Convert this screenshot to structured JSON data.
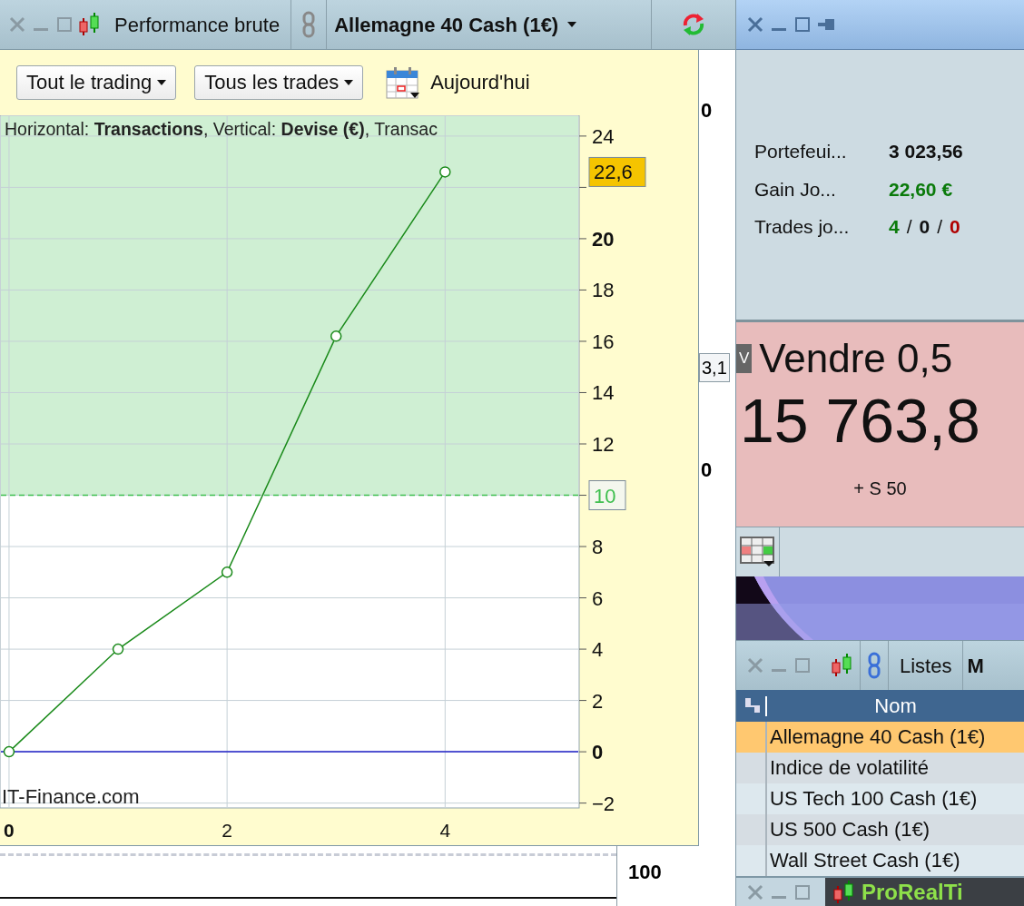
{
  "chart_window": {
    "title": "Performance brute",
    "instrument": "Allemagne 40 Cash (1€)",
    "filters": [
      {
        "label": "Tout le trading"
      },
      {
        "label": "Tous les trades"
      }
    ],
    "date_button": "Aujourd'hui",
    "chart_title": "Horizontal: **Transactions**, Vertical: **Devise (€)**, Transac",
    "credit": "IT-Finance.com",
    "chart_data": {
      "type": "line",
      "x": [
        0,
        1,
        2,
        3,
        4
      ],
      "series": [
        {
          "color": "#1a8a1a",
          "marker": "o",
          "values": [
            0,
            4,
            7,
            16.2,
            22.6
          ]
        }
      ],
      "xlim": [
        -0.083,
        5.23
      ],
      "ylim": [
        -2.19,
        24.81
      ],
      "xticks": [
        0,
        2,
        4
      ],
      "yticks": [
        -2,
        0,
        2,
        4,
        6,
        8,
        10,
        12,
        14,
        16,
        18,
        20,
        24
      ],
      "grid": true,
      "ref_lines": [
        {
          "axis": "y",
          "value": 0,
          "color": "#2020c8"
        },
        {
          "axis": "y",
          "value": 10,
          "color": "#3fbf4f",
          "label": "10"
        }
      ],
      "annotations": [
        "22,6"
      ]
    }
  },
  "background_chart": {
    "labels": [
      {
        "text": "0",
        "kind": "tick"
      },
      {
        "text": "3,1",
        "kind": "price"
      },
      {
        "text": "0",
        "kind": "tick"
      }
    ],
    "axis_label": "100"
  },
  "portfolio_panel": {
    "rows": [
      {
        "label": "Portefeui...",
        "parts": [
          {
            "text": "3 023,56",
            "kind": "value",
            "color": "#111111"
          }
        ]
      },
      {
        "label": "Gain Jo...",
        "parts": [
          {
            "text": "22,60 €",
            "kind": "value",
            "color": "#0a7a0a"
          }
        ]
      },
      {
        "label": "Trades jo...",
        "parts": [
          {
            "text": "4",
            "kind": "value",
            "color": "#0a7a0a"
          },
          {
            "text": "/",
            "kind": "separator"
          },
          {
            "text": "0",
            "kind": "value",
            "color": "#111111"
          },
          {
            "text": "/",
            "kind": "separator"
          },
          {
            "text": "0",
            "kind": "value",
            "color": "#b00000"
          }
        ]
      }
    ]
  },
  "order_panel": {
    "badge": "V",
    "action": "Vendre 0,5",
    "price": "15 763,8",
    "spread": "+ S 50"
  },
  "list_window": {
    "title": "Listes",
    "next_tab": "M",
    "column": "Nom",
    "rows": [
      {
        "name": "Allemagne 40 Cash (1€)",
        "selected": true
      },
      {
        "name": "Indice de volatilité",
        "selected": false
      },
      {
        "name": "US Tech 100 Cash (1€)",
        "selected": false
      },
      {
        "name": "US 500 Cash (1€)",
        "selected": false
      },
      {
        "name": "Wall Street Cash (1€)",
        "selected": false
      }
    ]
  },
  "bottom_tab": {
    "title": "ProRealTi"
  }
}
